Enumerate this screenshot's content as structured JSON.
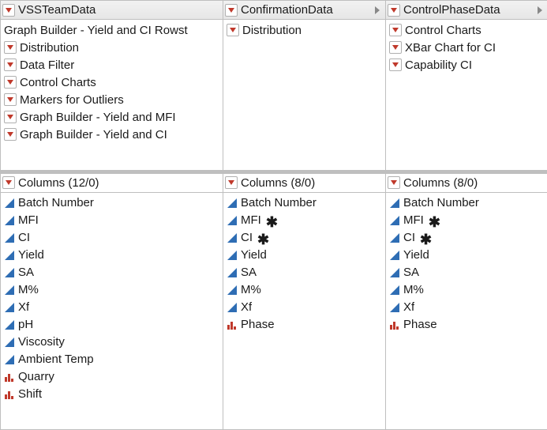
{
  "panels": [
    {
      "title": "VSSTeamData",
      "hasRightArrow": false,
      "scripts": [
        {
          "kind": "plain",
          "label": "Graph Builder - Yield and CI   Rowst"
        },
        {
          "kind": "menu",
          "label": "Distribution"
        },
        {
          "kind": "menu",
          "label": "Data Filter"
        },
        {
          "kind": "menu",
          "label": "Control Charts"
        },
        {
          "kind": "menu",
          "label": "Markers for Outliers"
        },
        {
          "kind": "menu",
          "label": "Graph Builder - Yield and MFI"
        },
        {
          "kind": "menu",
          "label": "Graph Builder - Yield and CI"
        }
      ],
      "columnsHeader": "Columns (12/0)",
      "columns": [
        {
          "icon": "cont",
          "label": "Batch Number",
          "formula": false
        },
        {
          "icon": "cont",
          "label": "MFI",
          "formula": false
        },
        {
          "icon": "cont",
          "label": "CI",
          "formula": false
        },
        {
          "icon": "cont",
          "label": "Yield",
          "formula": false
        },
        {
          "icon": "cont",
          "label": "SA",
          "formula": false
        },
        {
          "icon": "cont",
          "label": "M%",
          "formula": false
        },
        {
          "icon": "cont",
          "label": "Xf",
          "formula": false
        },
        {
          "icon": "cont",
          "label": "pH",
          "formula": false
        },
        {
          "icon": "cont",
          "label": "Viscosity",
          "formula": false
        },
        {
          "icon": "cont",
          "label": "Ambient Temp",
          "formula": false
        },
        {
          "icon": "nom",
          "label": "Quarry",
          "formula": false
        },
        {
          "icon": "nom",
          "label": "Shift",
          "formula": false
        }
      ]
    },
    {
      "title": "ConfirmationData",
      "hasRightArrow": true,
      "scripts": [
        {
          "kind": "menu",
          "label": "Distribution"
        }
      ],
      "columnsHeader": "Columns (8/0)",
      "columns": [
        {
          "icon": "cont",
          "label": "Batch Number",
          "formula": false
        },
        {
          "icon": "cont",
          "label": "MFI",
          "formula": true
        },
        {
          "icon": "cont",
          "label": "CI",
          "formula": true
        },
        {
          "icon": "cont",
          "label": "Yield",
          "formula": false
        },
        {
          "icon": "cont",
          "label": "SA",
          "formula": false
        },
        {
          "icon": "cont",
          "label": "M%",
          "formula": false
        },
        {
          "icon": "cont",
          "label": "Xf",
          "formula": false
        },
        {
          "icon": "nom",
          "label": "Phase",
          "formula": false
        }
      ]
    },
    {
      "title": "ControlPhaseData",
      "hasRightArrow": true,
      "scripts": [
        {
          "kind": "menu",
          "label": "Control Charts"
        },
        {
          "kind": "menu",
          "label": "XBar Chart for CI"
        },
        {
          "kind": "menu",
          "label": "Capability CI"
        }
      ],
      "columnsHeader": "Columns (8/0)",
      "columns": [
        {
          "icon": "cont",
          "label": "Batch Number",
          "formula": false
        },
        {
          "icon": "cont",
          "label": "MFI",
          "formula": true
        },
        {
          "icon": "cont",
          "label": "CI",
          "formula": true
        },
        {
          "icon": "cont",
          "label": "Yield",
          "formula": false
        },
        {
          "icon": "cont",
          "label": "SA",
          "formula": false
        },
        {
          "icon": "cont",
          "label": "M%",
          "formula": false
        },
        {
          "icon": "cont",
          "label": "Xf",
          "formula": false
        },
        {
          "icon": "nom",
          "label": "Phase",
          "formula": false
        }
      ]
    }
  ],
  "icons": {
    "redTriangle": "redTriangle",
    "continuous": "continuous",
    "nominal": "nominal",
    "rightChevron": "rightChevron"
  }
}
